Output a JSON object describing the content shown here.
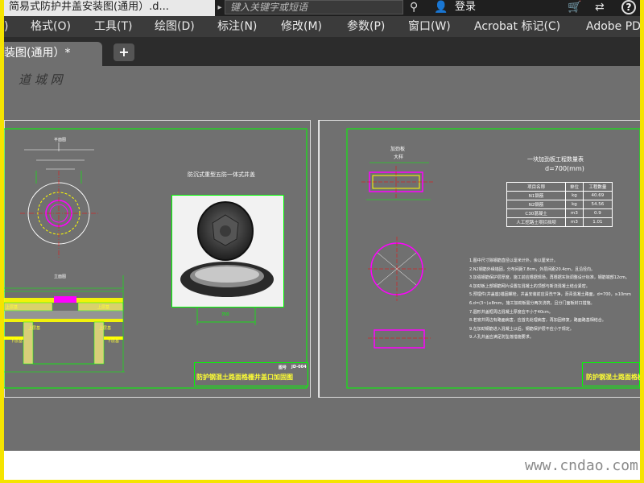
{
  "window": {
    "doc_title": "简易式防护井盖安装图(通用）.d...",
    "search_placeholder": "键入关键字或短语",
    "login_label": "登录",
    "help_label": "?"
  },
  "menu": {
    "items": [
      ")",
      "格式(O)",
      "工具(T)",
      "绘图(D)",
      "标注(N)",
      "修改(M)",
      "参数(P)",
      "窗口(W)",
      "Acrobat 标记(C)",
      "Adobe PD"
    ]
  },
  "tabs": {
    "active_label": "装图(通用）*",
    "close_label": "×",
    "add_label": "+"
  },
  "drawing_left": {
    "plan_label": "平面图",
    "section_label": "立面图",
    "photo_caption": "防沉式重型五防一体式井盖",
    "dim_label": "700",
    "layer_labels": [
      "上层基",
      "下层基",
      "上层基",
      "下层基",
      "上层基",
      "上层基"
    ],
    "title_block_name": "防护钢混土路面格栅井盖口加固图",
    "title_block_small": [
      "图号",
      "JD-004"
    ]
  },
  "drawing_right": {
    "rebar_label_1": "加劲板",
    "rebar_label_2": "大样",
    "qty_title": "一块加劲板工程数量表",
    "qty_subtitle": "d=700(mm)",
    "table": {
      "headers": [
        "项目名称",
        "单位",
        "工程数量"
      ],
      "rows": [
        [
          "N1钢筋",
          "kg",
          "40.69"
        ],
        [
          "N2钢筋",
          "kg",
          "54.56"
        ],
        [
          "C30混凝土",
          "m3",
          "0.9"
        ],
        [
          "人工挖路土坝拦挡坝",
          "m3",
          "1.01"
        ]
      ]
    },
    "notes": [
      "1.图中尺寸除钢筋直径以毫米计外，余以厘米计。",
      "2.N2钢筋外缘锚固，分布间距7.8cm，外层间距20.4cm，且沿径向。",
      "3.加强钢筋保护层厚度，施工前应根据现场，再根据实际调整设计标准，钢筋端部12cm。",
      "4.加劲板上部钢筋网片设置在混凝土的顶部与新浇混凝土结合紧密。",
      "5.预埋件(井盖座)锚固螺栓，井盖安装前应清洗干净，沥青混凝土路面，d=700，≥10mm",
      "6.d=(3~)≤8mm，施工加劲板需分两次浇筑，且分门面板封口措施。",
      "7.圆形井盖框周边混凝土厚度应不小于40cm。",
      "8.若窨井周边有路面病害，应首先处理病害，再加固修复，路面路基相结合。",
      "9.在加劲钢筋进入混凝土以后，钢筋保护层不应小于规定。",
      "9.人孔井盖应满足防坠落措施要求。"
    ],
    "title_block_name": "防护钢混土路面格栅井盖口加固图"
  },
  "watermarks": {
    "bottom": "www.cndao.com",
    "top": "道 城 网"
  },
  "colors": {
    "canvas": "#707070",
    "cad_green": "#00ff00",
    "cad_magenta": "#ff00ff",
    "cad_yellow": "#ffff00",
    "cad_white": "#ffffff",
    "menubar": "#3b3b3b",
    "frame_border": "#f5e400"
  },
  "icons": [
    "binoculars-icon",
    "user-icon",
    "cart-icon",
    "exchange-icon",
    "help-icon",
    "add-tab-icon"
  ]
}
